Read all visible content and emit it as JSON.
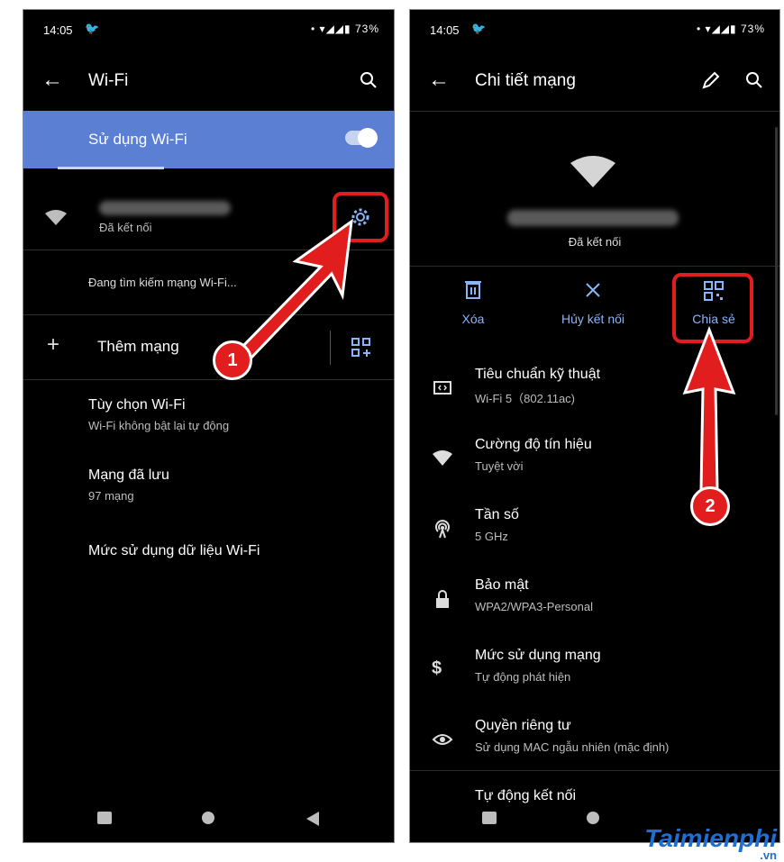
{
  "left": {
    "status": {
      "time": "14:05",
      "battery": "73%"
    },
    "appbar": {
      "title": "Wi-Fi"
    },
    "toggle_label": "Sử dụng Wi-Fi",
    "connected_status": "Đã kết nối",
    "searching": "Đang tìm kiếm mạng Wi-Fi...",
    "add_network": "Thêm mạng",
    "items": [
      {
        "title": "Tùy chọn Wi-Fi",
        "subtitle": "Wi-Fi không bật lại tự động"
      },
      {
        "title": "Mạng đã lưu",
        "subtitle": "97 mạng"
      },
      {
        "title": "Mức sử dụng dữ liệu Wi-Fi",
        "subtitle": ""
      }
    ],
    "step_badge": "1"
  },
  "right": {
    "status": {
      "time": "14:05",
      "battery": "73%"
    },
    "appbar": {
      "title": "Chi tiết mạng"
    },
    "connected_status": "Đã kết nối",
    "actions": [
      {
        "label": "Xóa",
        "icon": "trash-icon"
      },
      {
        "label": "Hủy kết nối",
        "icon": "close-icon"
      },
      {
        "label": "Chia sẻ",
        "icon": "qr-code-icon"
      }
    ],
    "details": [
      {
        "title": "Tiêu chuẩn kỹ thuật",
        "value": "Wi-Fi 5（802.11ac)",
        "icon": "wifi-standard-icon"
      },
      {
        "title": "Cường độ tín hiệu",
        "value": "Tuyệt vời",
        "icon": "signal-icon"
      },
      {
        "title": "Tần số",
        "value": "5 GHz",
        "icon": "frequency-icon"
      },
      {
        "title": "Bảo mật",
        "value": "WPA2/WPA3-Personal",
        "icon": "lock-icon"
      },
      {
        "title": "Mức sử dụng mạng",
        "value": "Tự động phát hiện",
        "icon": "dollar-icon"
      },
      {
        "title": "Quyền riêng tư",
        "value": "Sử dụng MAC ngẫu nhiên (mặc định)",
        "icon": "privacy-icon"
      },
      {
        "title": "Tự động kết nối",
        "value": "",
        "icon": ""
      }
    ],
    "step_badge": "2"
  },
  "watermark": {
    "brand": "Taimienphi",
    "tld": ".vn"
  },
  "colors": {
    "accent": "#5b7fd3",
    "link": "#8ab4f8",
    "highlight": "#e11d1d",
    "background": "#000000"
  }
}
